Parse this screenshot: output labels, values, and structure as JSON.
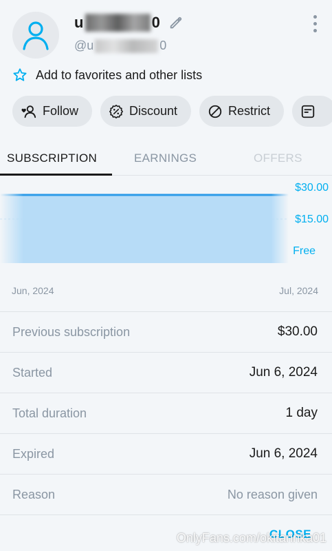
{
  "profile": {
    "display_name_start": "u",
    "display_name_end": "0",
    "handle_start": "@u",
    "handle_end": "0",
    "more_icon": "more-vertical-icon",
    "edit_icon": "pencil-icon",
    "avatar_icon": "user-icon"
  },
  "favorites": {
    "label": "Add to favorites and other lists",
    "icon": "star-outline-icon"
  },
  "actions": [
    {
      "label": "Follow",
      "icon": "follow-icon"
    },
    {
      "label": "Discount",
      "icon": "discount-icon"
    },
    {
      "label": "Restrict",
      "icon": "restrict-icon"
    }
  ],
  "tabs": {
    "subscription": "SUBSCRIPTION",
    "earnings": "EARNINGS",
    "offers": "OFFERS"
  },
  "chart_data": {
    "type": "area",
    "y_ticks": [
      "$30.00",
      "$15.00",
      "Free"
    ],
    "x_ticks": [
      "Jun, 2024",
      "Jul, 2024"
    ],
    "series": [
      {
        "x": [
          "Jun, 2024",
          "Jul, 2024"
        ],
        "values": [
          30,
          30
        ]
      }
    ],
    "ylim": [
      0,
      30
    ],
    "colors": {
      "line": "#2c9be8",
      "fill": "#b7dcf7",
      "ticks": "#00aff0"
    }
  },
  "details": [
    {
      "label": "Previous subscription",
      "value": "$30.00"
    },
    {
      "label": "Started",
      "value": "Jun 6, 2024"
    },
    {
      "label": "Total duration",
      "value": "1 day"
    },
    {
      "label": "Expired",
      "value": "Jun 6, 2024"
    },
    {
      "label": "Reason",
      "value": "No reason given"
    }
  ],
  "close_label": "CLOSE",
  "watermark": "OnlyFans.com/okitarinka01",
  "colors": {
    "accent": "#00aff0",
    "muted": "#8a96a3",
    "background": "#f3f6f9"
  }
}
